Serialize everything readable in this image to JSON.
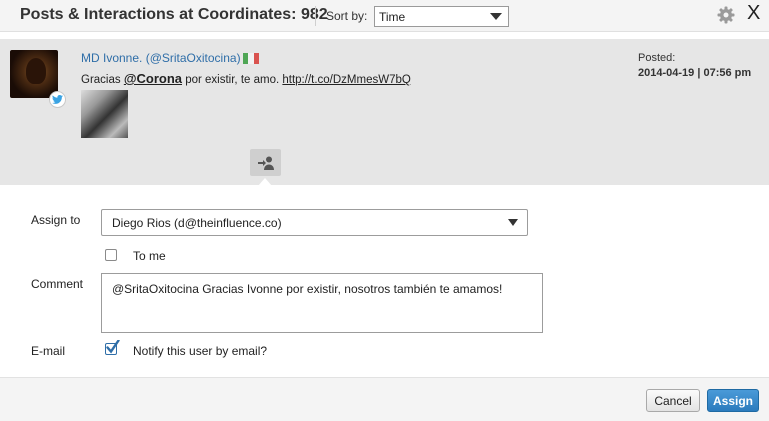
{
  "header": {
    "title": "Posts & Interactions at Coordinates: 982",
    "sort_label": "Sort by:",
    "sort_value": "Time",
    "close_glyph": "X"
  },
  "post": {
    "author": "MD Ivonne. (@SritaOxitocina)",
    "text_prefix": "Gracias ",
    "mention": "@Corona",
    "text_middle": " por existir, te amo. ",
    "link": "http://t.co/DzMmesW7bQ",
    "posted_label": "Posted:",
    "posted_value": "2014-04-19 | 07:56 pm",
    "network_icon": "twitter-icon"
  },
  "form": {
    "assign_label": "Assign to",
    "assign_value": "Diego Rios (d@theinfluence.co)",
    "to_me_label": "To me",
    "to_me_checked": false,
    "comment_label": "Comment",
    "comment_value": "@SritaOxitocina Gracias Ivonne por existir, nosotros también te amamos!",
    "email_label": "E-mail",
    "email_notify_label": "Notify this user by email?",
    "email_notify_checked": true
  },
  "footer": {
    "cancel_label": "Cancel",
    "assign_label": "Assign"
  },
  "colors": {
    "accent": "#2b7bbd",
    "link": "#2f6ea8"
  }
}
